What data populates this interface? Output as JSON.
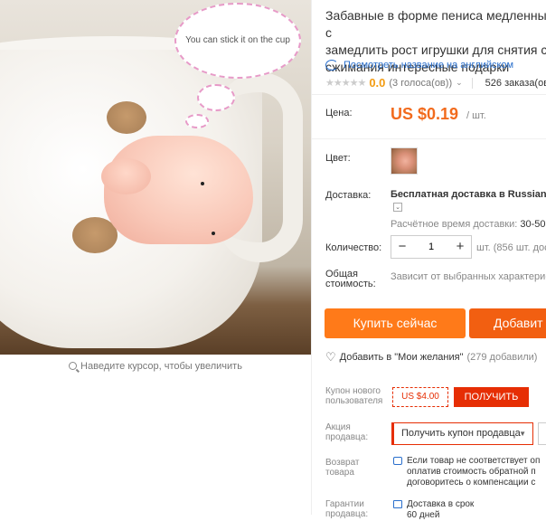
{
  "image": {
    "bubble_text": "You can stick it on the cup",
    "zoom_hint": "Наведите курсор, чтобы увеличить"
  },
  "product": {
    "title": "Забавные в форме пениса медленный с\nзамедлить рост игрушки для снятия стр\nсжимания интересные подарки",
    "translate_link": "Посмотреть название на английском",
    "rating_score": "0.0",
    "rating_count": "(3 голоса(ов))",
    "orders": "526 заказа(ов)",
    "stars": "★★★★★"
  },
  "price": {
    "label": "Цена:",
    "value": "US $0.19",
    "unit": "/ шт."
  },
  "color": {
    "label": "Цвет:"
  },
  "shipping": {
    "label": "Доставка:",
    "method": "Бесплатная доставка в Russian F",
    "time_label": "Расчётное время доставки:",
    "time_value": "30-50"
  },
  "quantity": {
    "label": "Количество:",
    "minus": "−",
    "value": "1",
    "plus": "+",
    "available": "шт. (856 шт. дос"
  },
  "total": {
    "label": "Общая\nстоимость:",
    "text": "Зависит от выбранных характерис"
  },
  "actions": {
    "buy": "Купить сейчас",
    "cart": "Добавит",
    "wishlist": "Добавить в \"Мои желания\"",
    "wishlist_count": "(279 добавили)"
  },
  "coupon": {
    "label": "Купон нового\nпользователя",
    "amount": "US $4.00",
    "get": "ПОЛУЧИТЬ"
  },
  "promo": {
    "label": "Акция\nпродавца:",
    "select": "Получить купон продавца"
  },
  "returns": {
    "label": "Возврат\nтовара",
    "text": "Если товар не соответствует оп\nоплатив стоимость обратной п\nдоговоритесь о компенсации с"
  },
  "guarantee": {
    "label": "Гарантии\nпродавца:",
    "text": "Доставка в срок\n60 дней"
  }
}
